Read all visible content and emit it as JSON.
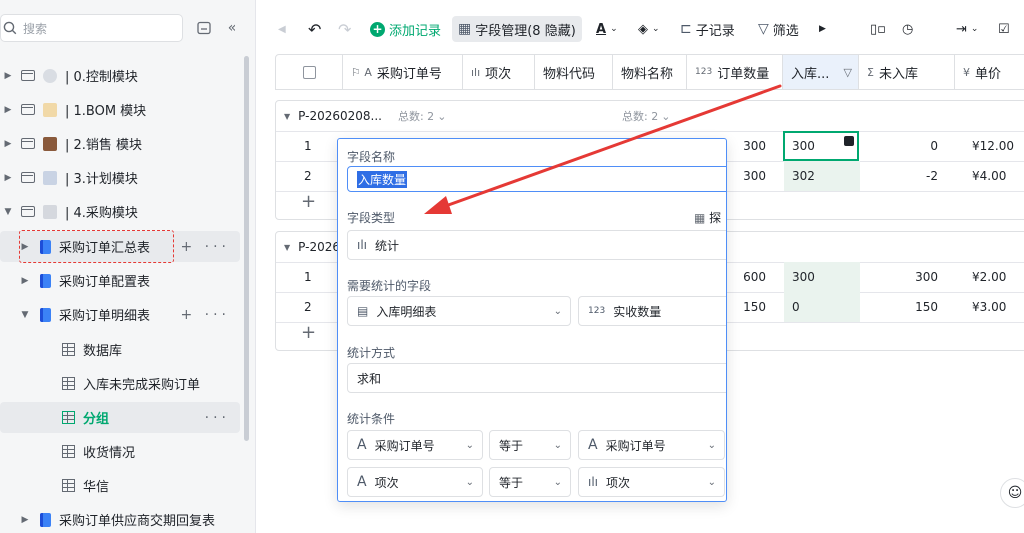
{
  "sidebar": {
    "search_placeholder": "搜索",
    "items": [
      {
        "label": "| 0.控制模块"
      },
      {
        "label": "| 1.BOM 模块"
      },
      {
        "label": "| 2.销售 模块"
      },
      {
        "label": "| 3.计划模块"
      },
      {
        "label": "| 4.采购模块"
      },
      {
        "label": "采购订单汇总表"
      },
      {
        "label": "采购订单配置表"
      },
      {
        "label": "采购订单明细表"
      },
      {
        "label": "数据库"
      },
      {
        "label": "入库未完成采购订单"
      },
      {
        "label": "分组"
      },
      {
        "label": "收货情况"
      },
      {
        "label": "华信"
      },
      {
        "label": "采购订单供应商交期回复表"
      }
    ]
  },
  "toolbar": {
    "add_record": "添加记录",
    "field_mgmt": "字段管理(8 隐藏)",
    "sub_record": "子记录",
    "filter": "筛选"
  },
  "grid": {
    "headers": [
      "采购订单号",
      "项次",
      "物料代码",
      "物料名称",
      "订单数量",
      "入库...",
      "未入库",
      "单价"
    ],
    "groups": [
      {
        "name": "P-20260208...",
        "total_label": "总数: 2",
        "total_label2": "总数: 2",
        "rows": [
          {
            "idx": "1",
            "qty": "300",
            "in": "300",
            "not_in": "0",
            "price": "¥12.00"
          },
          {
            "idx": "2",
            "qty": "300",
            "in": "302",
            "not_in": "-2",
            "price": "¥4.00"
          }
        ]
      },
      {
        "name": "P-2026",
        "rows": [
          {
            "idx": "1",
            "qty": "600",
            "in": "300",
            "not_in": "300",
            "price": "¥2.00"
          },
          {
            "idx": "2",
            "qty": "150",
            "in": "0",
            "not_in": "150",
            "price": "¥3.00"
          }
        ]
      }
    ]
  },
  "popup": {
    "field_name_label": "字段名称",
    "field_name_value": "入库数量",
    "field_type_label": "字段类型",
    "explore_label": "探",
    "field_type_value": "统计",
    "stat_field_label": "需要统计的字段",
    "stat_table": "入库明细表",
    "stat_field": "实收数量",
    "method_label": "统计方式",
    "method_value": "求和",
    "condition_label": "统计条件",
    "conditions": [
      {
        "left": "采购订单号",
        "op": "等于",
        "right": "采购订单号"
      },
      {
        "left": "项次",
        "op": "等于",
        "right": "项次"
      }
    ]
  },
  "colors": {
    "accent": "#2f6ee5",
    "add_green": "#00a870",
    "arrow_red": "#e53935"
  }
}
